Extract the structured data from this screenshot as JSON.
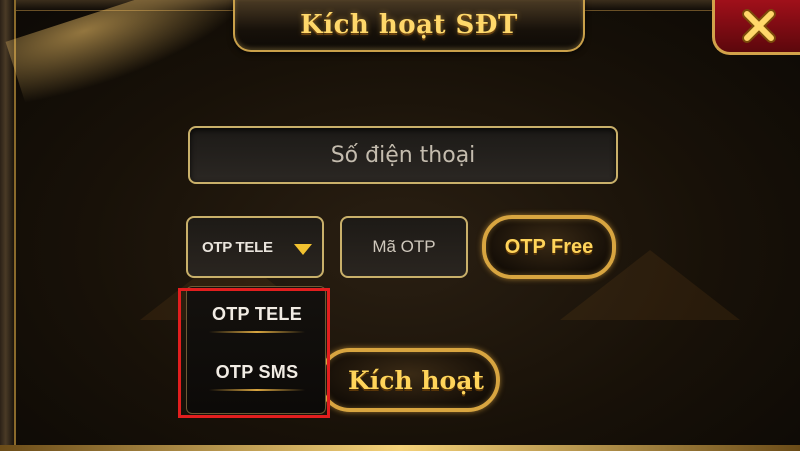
{
  "dialog": {
    "title": "Kích hoạt SĐT",
    "close_icon": "close-x-icon"
  },
  "form": {
    "phone_placeholder": "Số điện thoại",
    "otp_method_selected": "OTP TELE",
    "otp_placeholder": "Mã OTP",
    "otp_free_label": "OTP Free",
    "activate_label": "Kích hoạt"
  },
  "dropdown": {
    "options": [
      {
        "label": "OTP TELE"
      },
      {
        "label": "OTP SMS"
      }
    ]
  },
  "colors": {
    "accent_gold": "#ffd45a",
    "border_gold": "#c9b06a",
    "close_red": "#a0101a",
    "highlight_red": "#e21e1e"
  }
}
